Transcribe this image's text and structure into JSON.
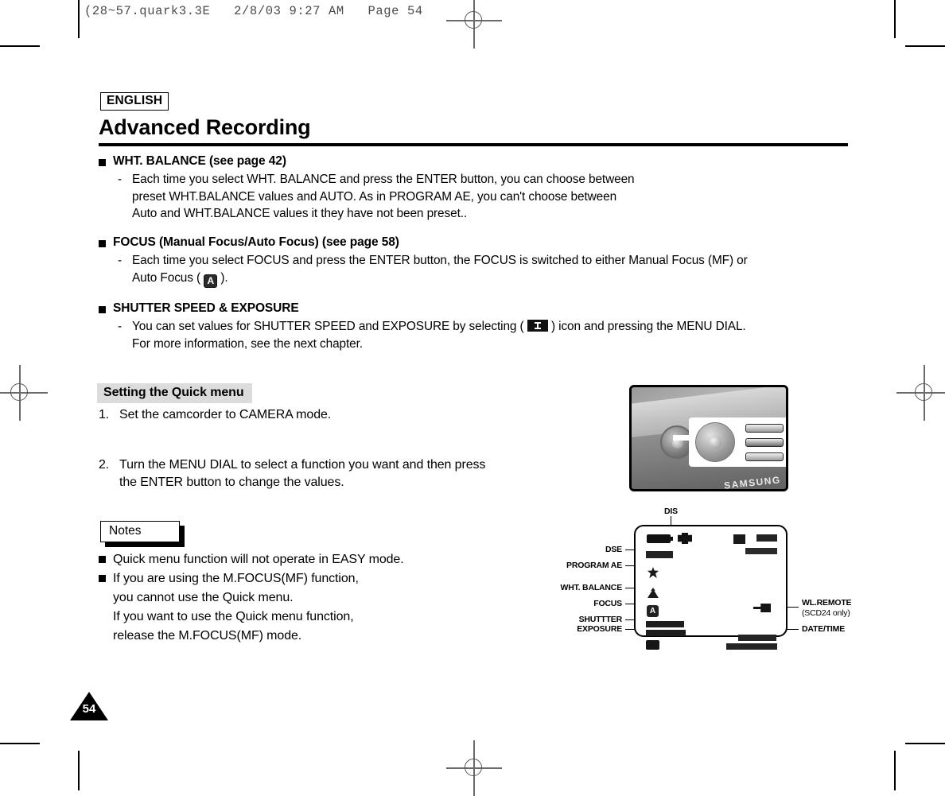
{
  "print_header": {
    "text": "(28~57.quark3.3E   2/8/03 9:27 AM   Page 54"
  },
  "header": {
    "language_badge": "ENGLISH",
    "title": "Advanced Recording"
  },
  "sections": [
    {
      "heading": "WHT. BALANCE (see page 42)",
      "dash": "-",
      "lines": [
        "Each time you select WHT. BALANCE and press the ENTER button, you can choose between",
        "preset WHT.BALANCE values and AUTO. As in PROGRAM AE, you can't choose between",
        "Auto and WHT.BALANCE values it they have not been preset.."
      ]
    },
    {
      "heading": "FOCUS (Manual Focus/Auto Focus) (see page 58)",
      "dash": "-",
      "lines": [
        "Each time you select FOCUS and press the ENTER button, the FOCUS is switched to either Manual Focus (MF) or",
        "Auto Focus (  )."
      ],
      "line_a_prefix": "Each time you select FOCUS and press the ENTER button, the FOCUS is switched to either Manual Focus (MF) or",
      "line_b_prefix": "Auto Focus ( ",
      "line_b_suffix": " ).",
      "inline_icon": "auto-focus-A-icon"
    },
    {
      "heading": "SHUTTER SPEED & EXPOSURE",
      "dash": "-",
      "line_a_prefix": "You can set values for SHUTTER SPEED and EXPOSURE by selecting ( ",
      "line_a_suffix": " ) icon and pressing the MENU DIAL.",
      "line_b": "For more information, see the next chapter.",
      "inline_icon": "exposure-icon"
    }
  ],
  "quick_menu": {
    "section_title": "Setting the Quick menu",
    "steps": [
      {
        "num": "1.",
        "text": "Set the camcorder to CAMERA mode."
      },
      {
        "num": "2.",
        "line1": "Turn the MENU DIAL to select a function you want and then press",
        "line2": "the ENTER button to change the values."
      }
    ]
  },
  "notes": {
    "label": "Notes",
    "items": [
      {
        "lines": [
          "Quick menu function will not operate in EASY mode."
        ]
      },
      {
        "lines": [
          "If you are using the M.FOCUS(MF) function,",
          "you cannot use the Quick menu.",
          "If you want to use the Quick menu function,",
          "release the M.FOCUS(MF) mode."
        ]
      }
    ]
  },
  "figure_photo": {
    "brand": "SAMSUNG"
  },
  "lcd_diagram": {
    "labels_top": [
      "DIS"
    ],
    "labels_left": [
      "DSE",
      "PROGRAM AE",
      "WHT. BALANCE",
      "FOCUS",
      "SHUTTTER",
      "EXPOSURE"
    ],
    "labels_right": [
      "WL.REMOTE",
      "(SCD24 only)",
      "DATE/TIME"
    ]
  },
  "footer": {
    "page_number": "54"
  },
  "colors": {
    "text": "#000000",
    "section_bg": "#dcdcdc",
    "header_gray": "#4a4a4a"
  }
}
